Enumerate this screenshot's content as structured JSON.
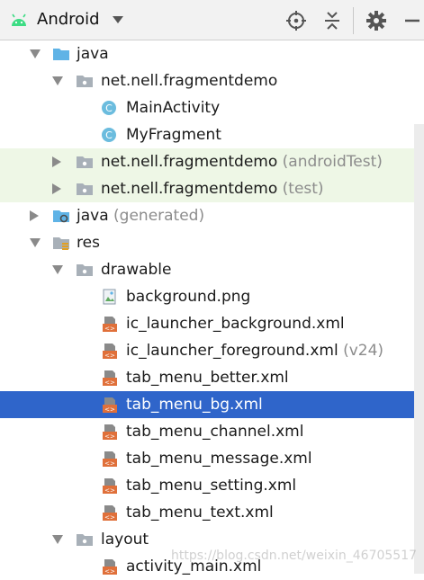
{
  "toolbar": {
    "title": "Android",
    "icons": [
      "android-icon",
      "caret-down-icon",
      "locate-icon",
      "collapse-icon",
      "gear-icon",
      "hide-icon"
    ]
  },
  "tree": [
    {
      "label": "java",
      "suffix": ""
    },
    {
      "label": "net.nell.fragmentdemo",
      "suffix": ""
    },
    {
      "label": "MainActivity",
      "suffix": ""
    },
    {
      "label": "MyFragment",
      "suffix": ""
    },
    {
      "label": "net.nell.fragmentdemo",
      "suffix": "(androidTest)"
    },
    {
      "label": "net.nell.fragmentdemo",
      "suffix": "(test)"
    },
    {
      "label": "java",
      "suffix": "(generated)"
    },
    {
      "label": "res",
      "suffix": ""
    },
    {
      "label": "drawable",
      "suffix": ""
    },
    {
      "label": "background.png",
      "suffix": ""
    },
    {
      "label": "ic_launcher_background.xml",
      "suffix": ""
    },
    {
      "label": "ic_launcher_foreground.xml",
      "suffix": "(v24)"
    },
    {
      "label": "tab_menu_better.xml",
      "suffix": ""
    },
    {
      "label": "tab_menu_bg.xml",
      "suffix": ""
    },
    {
      "label": "tab_menu_channel.xml",
      "suffix": ""
    },
    {
      "label": "tab_menu_message.xml",
      "suffix": ""
    },
    {
      "label": "tab_menu_setting.xml",
      "suffix": ""
    },
    {
      "label": "tab_menu_text.xml",
      "suffix": ""
    },
    {
      "label": "layout",
      "suffix": ""
    },
    {
      "label": "activity_main.xml",
      "suffix": ""
    }
  ],
  "watermark": "https://blog.csdn.net/weixin_46705517",
  "colors": {
    "selection": "#2f65ca",
    "test_bg": "#eef7e6",
    "android_green": "#3ddc84",
    "class_icon": "#6bbcde",
    "xml_icon": "#e0703a"
  }
}
